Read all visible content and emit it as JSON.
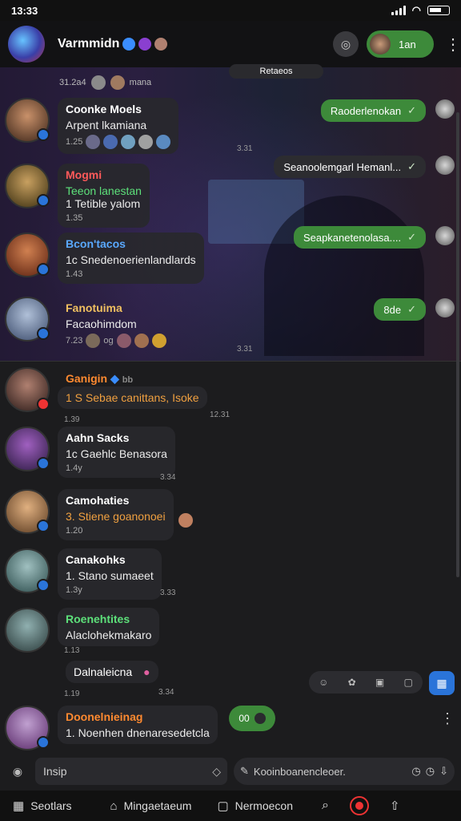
{
  "status": {
    "time": "13:33"
  },
  "header": {
    "title": "Varmmidn",
    "call_icon": "phone-icon",
    "live_label": "1an",
    "menu_icon": "more-vertical-icon"
  },
  "pinned": {
    "label": "Retaeos"
  },
  "date_row": {
    "date": "31.2a4",
    "label": "mana"
  },
  "outgoing": [
    {
      "text": "Raoderlenokan",
      "status": "sent"
    },
    {
      "text": "Seanoolemgarl Hemanl...",
      "status": "sent"
    },
    {
      "text": "Seapkanetenolasa....",
      "status": "sent"
    },
    {
      "text": "8de",
      "status": "sent"
    }
  ],
  "messages": [
    {
      "sender": "Coonke Moels",
      "text": "Arpent lkamiana",
      "time": "1.25",
      "side_time": "3.31",
      "sender_color": "#ffffff"
    },
    {
      "sender": "Mogmi",
      "text": "Teeon lanestan",
      "text2": "1 Tetible yalom",
      "time": "1.35",
      "sender_color": "#ff5a5a",
      "text_color": "#5de07a"
    },
    {
      "sender": "Bcon'tacos",
      "text": "1c Snedenoerienlandlards",
      "time": "1.43",
      "sender_color": "#5aa9ff"
    },
    {
      "sender": "Fanotuima",
      "text": "Facaohimdom",
      "time": "7.23",
      "extra": "og",
      "side_time": "3.31",
      "sender_color": "#f0c060"
    },
    {
      "sender": "Ganigin",
      "text": "1 S Sebae canittans, Isoke",
      "time": "1.39",
      "side_time": "12.31",
      "sender_color": "#ff8a30",
      "text_color": "#f0a040",
      "badge": "bb"
    },
    {
      "sender": "Aahn Sacks",
      "text": "1c Gaehlc Benasora",
      "time": "1.4y",
      "side_time": "3.34",
      "sender_color": "#ffffff"
    },
    {
      "sender": "Camohaties",
      "text": "3. Stiene goanonoei",
      "time": "1.20",
      "sender_color": "#ffffff",
      "text_color": "#f0a040"
    },
    {
      "sender": "Canakohks",
      "text": "1. Stano sumaeet",
      "time": "1.3y",
      "side_time": "3.33",
      "sender_color": "#ffffff"
    },
    {
      "sender": "Roenehtites",
      "text": "Alaclohekmakaro",
      "time": "1.13",
      "sender_color": "#5de07a",
      "followup": "Dalnaleicna",
      "followup_time": "1.19",
      "side_time": "3.34"
    },
    {
      "sender": "Doonelnieinag",
      "text": "1. Noenhen dnenaresedetcla",
      "time": "",
      "sender_color": "#ff8a30"
    }
  ],
  "typing": {
    "label": "00"
  },
  "input": {
    "placeholder": "Insip",
    "second_placeholder": "Kooinboanencleoer."
  },
  "nav": {
    "home_label": "Seotlars",
    "mid_label": "Mingaetaeum",
    "right_label": "Nermoecon"
  },
  "colors": {
    "accent_green": "#3d8a3a",
    "accent_blue": "#2a74d9"
  }
}
